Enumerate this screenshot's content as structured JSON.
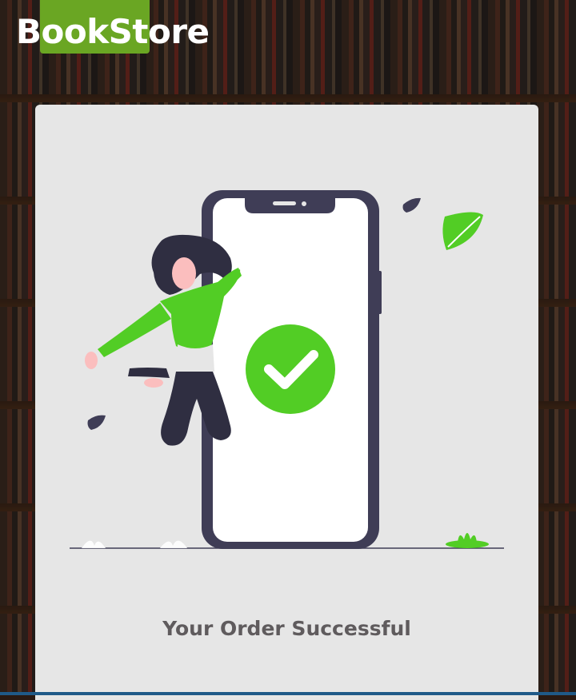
{
  "brand": {
    "name": "BookStore"
  },
  "order": {
    "message": "Your Order Successful"
  },
  "colors": {
    "brand_green": "#6aa623",
    "success_green": "#52cd25",
    "card_bg": "#e6e6e6",
    "text_gray": "#5f5b5d",
    "phone_dark": "#3f3d56"
  },
  "icons": {
    "status": "check-circle-icon",
    "illustration": "person-jumping-with-phone"
  }
}
